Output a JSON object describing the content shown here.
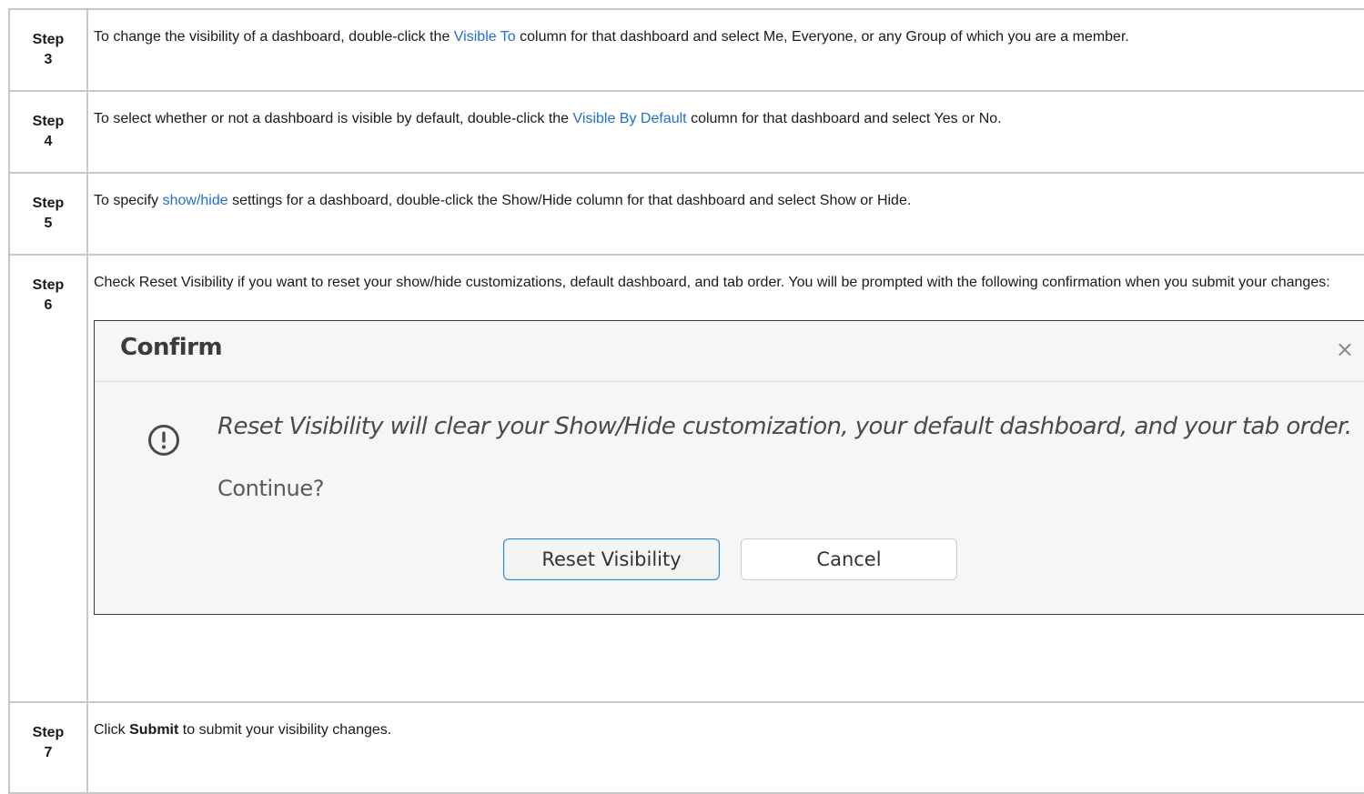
{
  "steps": [
    {
      "label": "Step",
      "number": "3",
      "parts": [
        {
          "t": "To change the visibility of a dashboard, double-click the "
        },
        {
          "t": "Visible To",
          "link": true
        },
        {
          "t": " column for that dashboard and select Me, Everyone, or any Group of which you are a member."
        }
      ]
    },
    {
      "label": "Step",
      "number": "4",
      "parts": [
        {
          "t": "To select whether or not a dashboard is visible by default, double-click the "
        },
        {
          "t": "Visible By Default",
          "link": true
        },
        {
          "t": " column for that dashboard and select Yes or No."
        }
      ]
    },
    {
      "label": "Step",
      "number": "5",
      "parts": [
        {
          "t": "To specify "
        },
        {
          "t": "show/hide",
          "link": true
        },
        {
          "t": " settings for a dashboard, double-click the Show/Hide column for that dashboard and select Show or Hide."
        }
      ]
    },
    {
      "label": "Step",
      "number": "6",
      "parts": [
        {
          "t": "Check Reset Visibility if you want to reset your show/hide customizations, default dashboard, and tab order. You will be prompted with the following confirmation when you submit your changes:"
        }
      ]
    },
    {
      "label": "Step",
      "number": "7",
      "parts": [
        {
          "t": "Click "
        },
        {
          "t": "Submit",
          "bold": true
        },
        {
          "t": " to submit your visibility changes."
        }
      ]
    }
  ],
  "dialog": {
    "title": "Confirm",
    "close_glyph": "×",
    "message": "Reset Visibility will clear your Show/Hide customization, your default dashboard, and your tab order.",
    "question": "Continue?",
    "primary_button": "Reset Visibility",
    "secondary_button": "Cancel",
    "icon": "warning-circle-icon"
  },
  "colors": {
    "link": "#1f6fd1",
    "border": "#c8c8c8",
    "primary_button_border": "#2f86c4"
  }
}
